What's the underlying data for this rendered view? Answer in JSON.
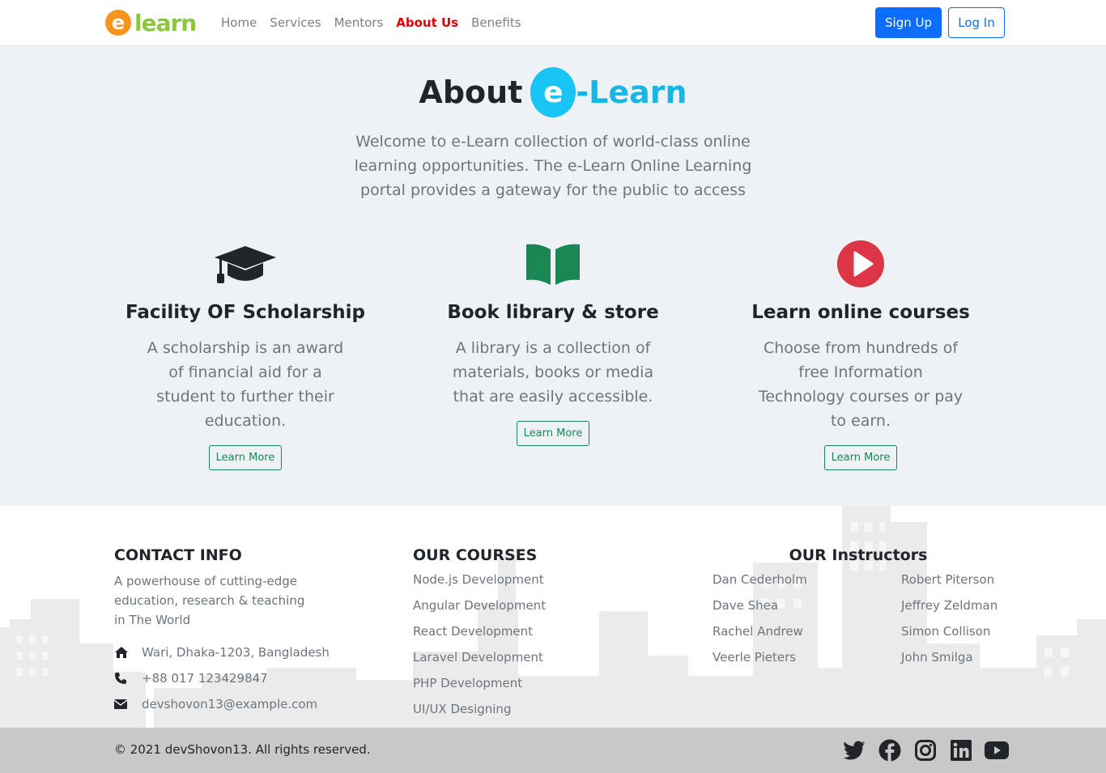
{
  "nav": {
    "logo_text": "e-learn",
    "links": [
      {
        "label": "Home",
        "active": false
      },
      {
        "label": "Services",
        "active": false
      },
      {
        "label": "Mentors",
        "active": false
      },
      {
        "label": "About Us",
        "active": true
      },
      {
        "label": "Benefits",
        "active": false
      }
    ],
    "signup_label": "Sign Up",
    "login_label": "Log In"
  },
  "about": {
    "title_prefix": "About",
    "brand_circle": "e",
    "brand_rest": "-Learn",
    "description": "Welcome to e-Learn collection of world-class online learning opportunities. The e-Learn Online Learning portal provides a gateway for the public to access"
  },
  "features": [
    {
      "icon": "graduation-cap-icon",
      "title": "Facility OF Scholarship",
      "text": "A scholarship is an award of financial aid for a student to further their education.",
      "button": "Learn More"
    },
    {
      "icon": "book-open-icon",
      "title": "Book library & store",
      "text": "A library is a collection of materials, books or media that are easily accessible.",
      "button": "Learn More"
    },
    {
      "icon": "play-circle-icon",
      "title": "Learn online courses",
      "text": "Choose from hundreds of free Information Technology courses or pay to earn.",
      "button": "Learn More"
    }
  ],
  "footer": {
    "contact": {
      "heading": "CONTACT INFO",
      "intro": "A powerhouse of cutting-edge education, research & teaching in The World",
      "address": "Wari, Dhaka-1203, Bangladesh",
      "phone": "+88 017 123429847",
      "email": "devshovon13@example.com"
    },
    "courses": {
      "heading": "OUR COURSES",
      "items": [
        "Node.js Development",
        "Angular Development",
        "React Development",
        "Laravel Development",
        "PHP Development",
        "UI/UX Designing"
      ]
    },
    "instructors": {
      "heading": "OUR Instructors",
      "col1": [
        "Dan Cederholm",
        "Dave Shea",
        "Rachel Andrew",
        "Veerle Pieters"
      ],
      "col2": [
        "Robert Piterson",
        "Jeffrey Zeldman",
        "Simon Collison",
        "John Smilga"
      ]
    },
    "copyright": "© 2021 devShovon13. All rights reserved.",
    "socials": [
      "twitter-icon",
      "facebook-icon",
      "instagram-icon",
      "linkedin-icon",
      "youtube-icon"
    ]
  },
  "colors": {
    "accent_blue": "#0d6efd",
    "nav_active": "#e00000",
    "brand_cyan": "#17c4f3",
    "green": "#198754",
    "play_red": "#dc3545"
  }
}
